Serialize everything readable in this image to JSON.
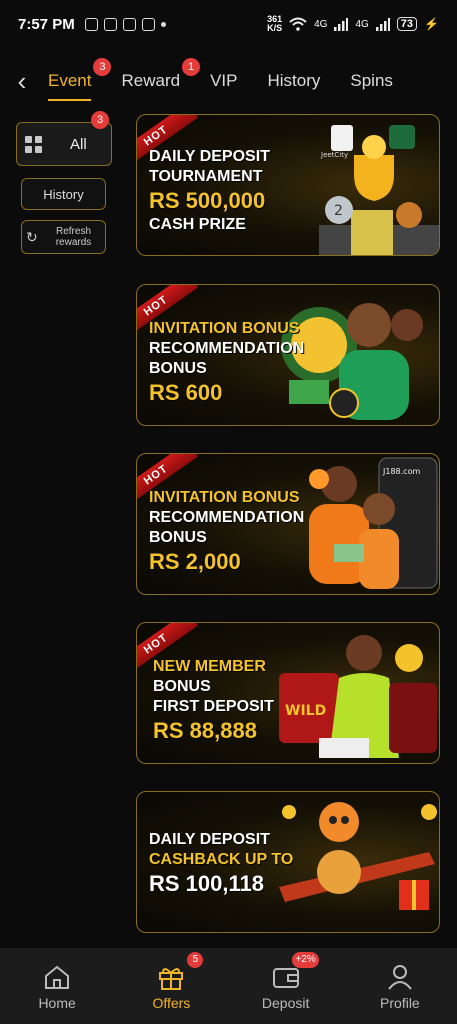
{
  "status_bar": {
    "time": "7:57 PM",
    "net_speed_value": "361",
    "net_speed_unit": "K/S",
    "signal_a": "4G",
    "signal_b": "4G",
    "battery": "73"
  },
  "tabs": [
    {
      "label": "Event",
      "badge": "3"
    },
    {
      "label": "Reward",
      "badge": "1"
    },
    {
      "label": "VIP"
    },
    {
      "label": "History"
    },
    {
      "label": "Spins"
    }
  ],
  "sidebar": {
    "all_label": "All",
    "all_badge": "3",
    "history_label": "History",
    "refresh_label_1": "Refresh",
    "refresh_label_2": "rewards"
  },
  "banners": [
    {
      "ribbon": "HOT",
      "line1": "DAILY DEPOSIT",
      "line2": "TOURNAMENT",
      "amount": "Rs 500,000",
      "line4": "CASH PRIZE",
      "art_text": "JeetCity"
    },
    {
      "ribbon": "HOT",
      "line1": "INVITATION BONUS",
      "line2": "RECOMMENDATION",
      "line3": "BONUS",
      "amount": "Rs 600"
    },
    {
      "ribbon": "HOT",
      "line1": "INVITATION BONUS",
      "line2": "RECOMMENDATION",
      "line3": "BONUS",
      "amount": "Rs 2,000",
      "art_text": "J188.com"
    },
    {
      "ribbon": "HOT",
      "line1": "NEW MEMBER",
      "line2": "BONUS",
      "line3": "FIRST DEPOSIT",
      "amount": "Rs 88,888",
      "art_text": "WILD"
    },
    {
      "line1": "DAILY DEPOSIT",
      "line2": "CASHBACK UP TO",
      "amount": "Rs 100,118"
    }
  ],
  "bottom_nav": [
    {
      "label": "Home",
      "icon": "home-icon"
    },
    {
      "label": "Offers",
      "icon": "gift-icon",
      "badge": "5"
    },
    {
      "label": "Deposit",
      "icon": "wallet-icon",
      "badge": "+2%"
    },
    {
      "label": "Profile",
      "icon": "person-icon"
    }
  ],
  "colors": {
    "accent": "#f0b429",
    "badge": "#e43b3b",
    "ribbon": "#c0141a",
    "nav_bg": "#1c1c1c"
  }
}
